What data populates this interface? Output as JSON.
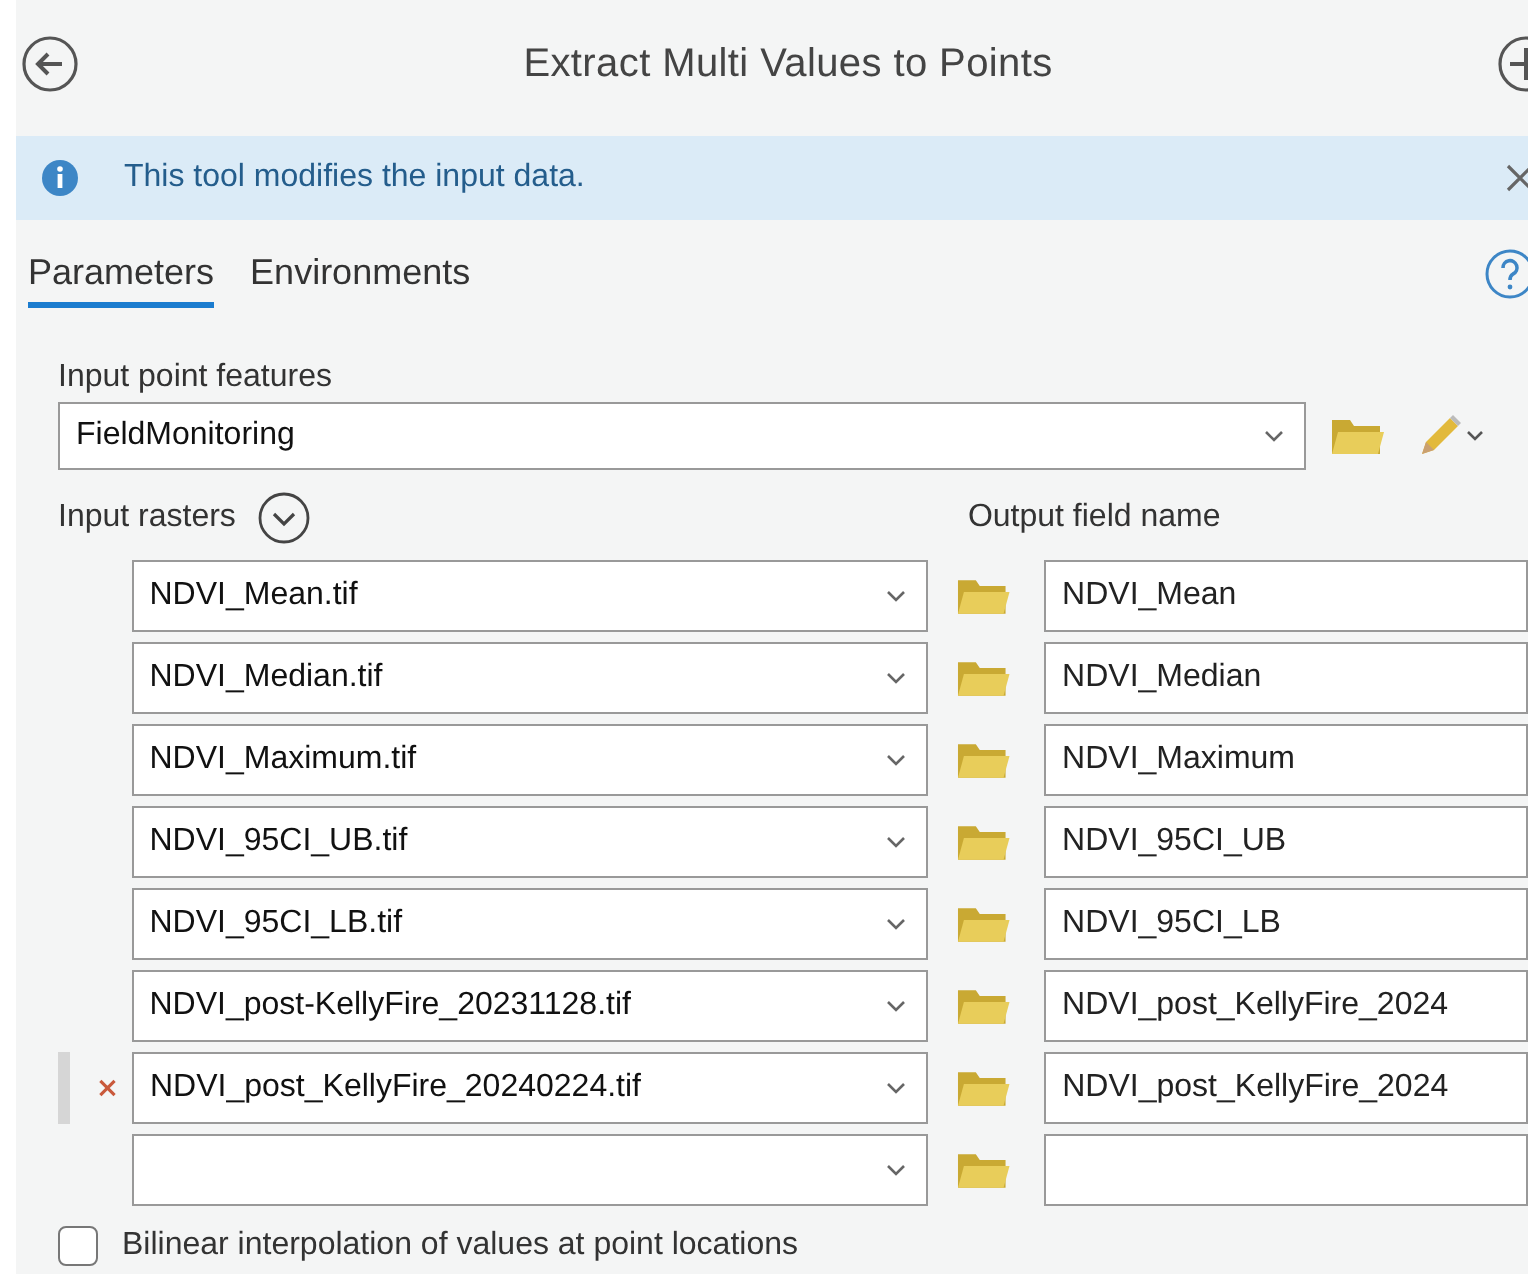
{
  "header": {
    "title": "Extract Multi Values to Points"
  },
  "info_bar": {
    "message": "This tool modifies the input data."
  },
  "tabs": [
    {
      "label": "Parameters",
      "selected": true
    },
    {
      "label": "Environments",
      "selected": false
    }
  ],
  "input_point_features": {
    "label": "Input point features",
    "value": "FieldMonitoring"
  },
  "input_rasters": {
    "label": "Input rasters",
    "output_label": "Output field name",
    "rows": [
      {
        "raster": "NDVI_Mean.tif",
        "field_name": "NDVI_Mean",
        "selected": false
      },
      {
        "raster": "NDVI_Median.tif",
        "field_name": "NDVI_Median",
        "selected": false
      },
      {
        "raster": "NDVI_Maximum.tif",
        "field_name": "NDVI_Maximum",
        "selected": false
      },
      {
        "raster": "NDVI_95CI_UB.tif",
        "field_name": "NDVI_95CI_UB",
        "selected": false
      },
      {
        "raster": "NDVI_95CI_LB.tif",
        "field_name": "NDVI_95CI_LB",
        "selected": false
      },
      {
        "raster": "NDVI_post-KellyFire_20231128.tif",
        "field_name": "NDVI_post_KellyFire_2024",
        "selected": false
      },
      {
        "raster": "NDVI_post_KellyFire_20240224.tif",
        "field_name": "NDVI_post_KellyFire_2024",
        "selected": true
      },
      {
        "selected": false
      }
    ]
  },
  "bilinear": {
    "label": "Bilinear interpolation of values at point locations",
    "checked": false
  }
}
